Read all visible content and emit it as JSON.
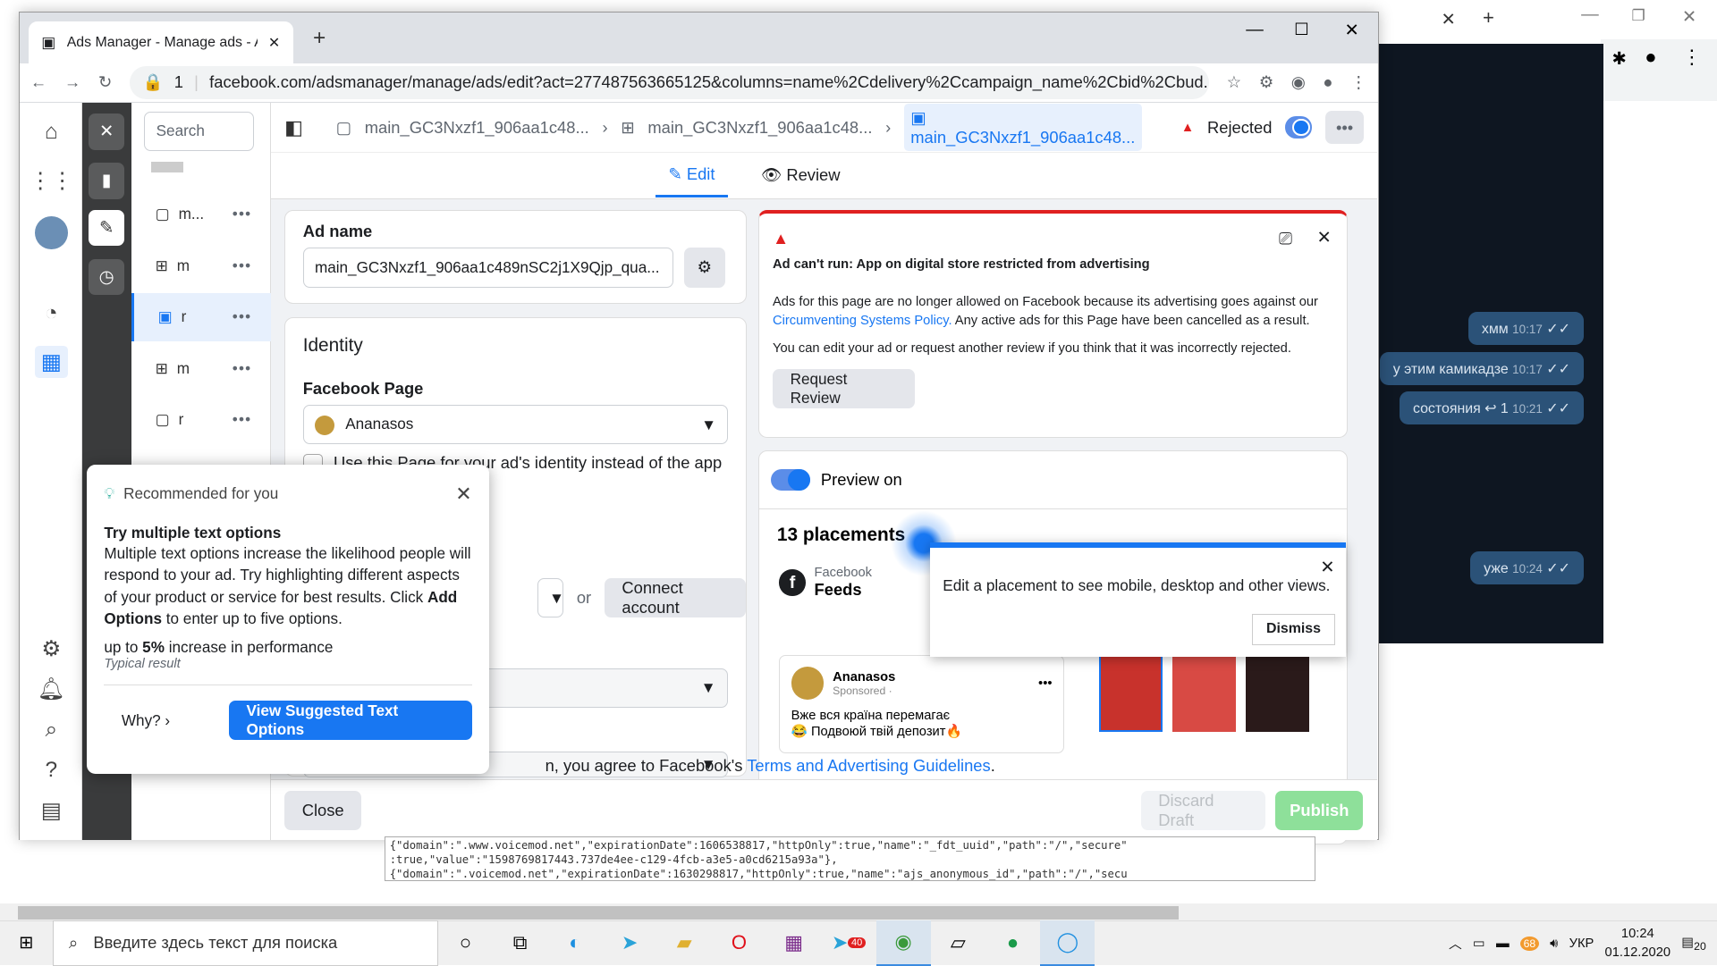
{
  "browser": {
    "tab_title": "Ads Manager - Manage ads - Ad",
    "url_prefix": "1",
    "url": "facebook.com/adsmanager/manage/ads/edit?act=277487563665125&columns=name%2Cdelivery%2Ccampaign_name%2Cbid%2Cbud..."
  },
  "tree": {
    "search_placeholder": "Search",
    "rows": [
      {
        "label": "m...",
        "icon": "folder-icon"
      },
      {
        "label": "m",
        "icon": "grid-icon"
      },
      {
        "label": "r",
        "icon": "ad-icon"
      },
      {
        "label": "m",
        "icon": "grid-icon"
      },
      {
        "label": "r",
        "icon": "ad-icon"
      }
    ]
  },
  "crumb": {
    "campaign": "main_GC3Nxzf1_906aa1c48...",
    "adset": "main_GC3Nxzf1_906aa1c48...",
    "ad": "main_GC3Nxzf1_906aa1c48...",
    "status": "Rejected"
  },
  "tabs": {
    "edit": "Edit",
    "review": "Review"
  },
  "ad_name": {
    "label": "Ad name",
    "value": "main_GC3Nxzf1_906aa1c489nSC2j1X9Qjp_qua..."
  },
  "identity": {
    "title": "Identity",
    "page_label": "Facebook Page",
    "page_value": "Ananasos",
    "checkbox_text": "Use this Page for your ad's identity instead of the app",
    "or": "or",
    "connect": "Connect account"
  },
  "alert": {
    "title": "Ad can't run: App on digital store restricted from advertising",
    "body1": "Ads for this page are no longer allowed on Facebook because its advertising goes against our",
    "link": "Circumventing Systems Policy.",
    "body2": " Any active ads for this Page have been cancelled as a result.",
    "body3": "You can edit your ad or request another review if you think that it was incorrectly rejected.",
    "button": "Request Review"
  },
  "preview": {
    "toggle_label": "Preview on",
    "placements": "13 placements",
    "platform": "Facebook",
    "position": "Feeds",
    "advertiser": "Ananasos",
    "sponsored": "Sponsored · ",
    "text1": "Вже вся країна перемагає",
    "text2": "😂 Подвоюй твій депозит🔥"
  },
  "tip": {
    "text": "Edit a placement to see mobile, desktop and other views.",
    "dismiss": "Dismiss"
  },
  "reco": {
    "header": "Recommended for you",
    "title": "Try multiple text options",
    "body": "Multiple text options increase the likelihood people will respond to your ad. Try highlighting different aspects of your product or service for best results. Click ",
    "body_bold": "Add Options",
    "body_end": " to enter up to five options.",
    "perf_pre": "up to ",
    "perf_bold": "5%",
    "perf_post": " increase in performance",
    "typical": "Typical result",
    "why": "Why?",
    "cta": "View Suggested Text Options"
  },
  "footer": {
    "terms_pre": "n, you agree to Facebook's ",
    "terms_link": "Terms and Advertising Guidelines",
    "terms_post": ".",
    "close": "Close",
    "discard": "Discard Draft",
    "publish": "Publish"
  },
  "chat": {
    "m1": "хмм",
    "t1": "10:17",
    "m2": "у этим камикадзе",
    "t2": "10:17",
    "m3": "состояния",
    "t3": "10:21",
    "m4": "уже",
    "t4": "10:24"
  },
  "json_text": {
    "l1": "{\"domain\":\".www.voicemod.net\",\"expirationDate\":1606538817,\"httpOnly\":true,\"name\":\"_fdt_uuid\",\"path\":\"/\",\"secure\"",
    "l2": ":true,\"value\":\"1598769817443.737de4ee-c129-4fcb-a3e5-a0cd6215a93a\"},",
    "l3": "{\"domain\":\".voicemod.net\",\"expirationDate\":1630298817,\"httpOnly\":true,\"name\":\"ajs_anonymous_id\",\"path\":\"/\",\"secu"
  },
  "taskbar": {
    "search": "Введите здесь текст для поиска",
    "lang": "УКР",
    "time": "10:24",
    "date": "01.12.2020",
    "notif": "20",
    "badge": "40",
    "battery": "68"
  },
  "colors": {
    "fb_blue": "#1877f2",
    "publish_green": "#8ee09a",
    "alert_red": "#e02020"
  }
}
